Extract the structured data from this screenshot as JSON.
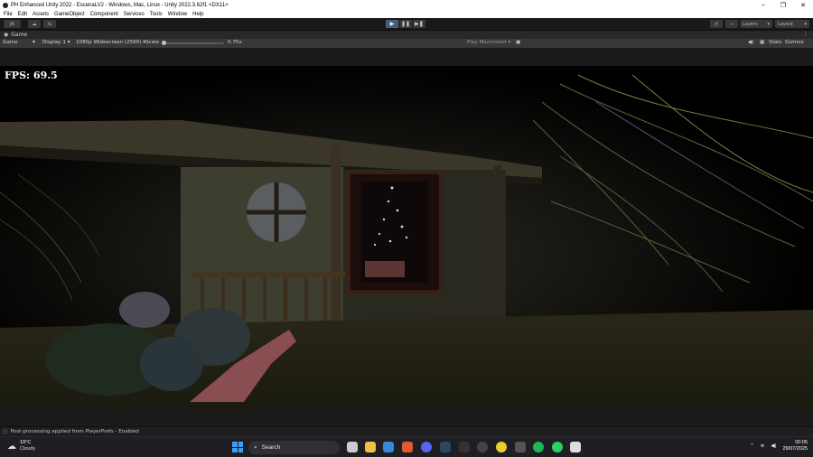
{
  "window": {
    "title": "PH Enhanced Unity 2022 - EscenaLV2 - Windows, Mac, Linux - Unity 2022.3.62f1 <DX11>",
    "controls": [
      "–",
      "❐",
      "✕"
    ]
  },
  "menu": [
    "File",
    "Edit",
    "Assets",
    "GameObject",
    "Component",
    "Services",
    "Tools",
    "Window",
    "Help"
  ],
  "toolbar": {
    "account": "JA",
    "layers_label": "Layers",
    "layout_label": "Layout",
    "play_controls": [
      "▶",
      "❚❚",
      "▶❚"
    ]
  },
  "panel": {
    "tab_label": "Game"
  },
  "game_toolbar": {
    "mode": "Game",
    "display": "Display 1",
    "resolution": "1080p Widescreen (2560)",
    "scale_label": "Scale",
    "scale_value": "0.75x",
    "scale_fraction": 0.02,
    "play_mode": "Play Maximized",
    "stats_label": "Stats",
    "gizmos_label": "Gizmos"
  },
  "game": {
    "fps_text": "FPS: 69.5"
  },
  "status": {
    "message": "Post-processing applied from PlayerPrefs - Enabled"
  },
  "taskbar": {
    "temperature": "19°C",
    "condition": "Cloudy",
    "search_placeholder": "Search",
    "time": "00:05",
    "date": "29/07/2025"
  },
  "colors": {
    "editor_bg": "#191919",
    "play_active": "#46607c",
    "taskbar_bg": "#1f1f23",
    "windows_blue": "#3aa0f3"
  }
}
